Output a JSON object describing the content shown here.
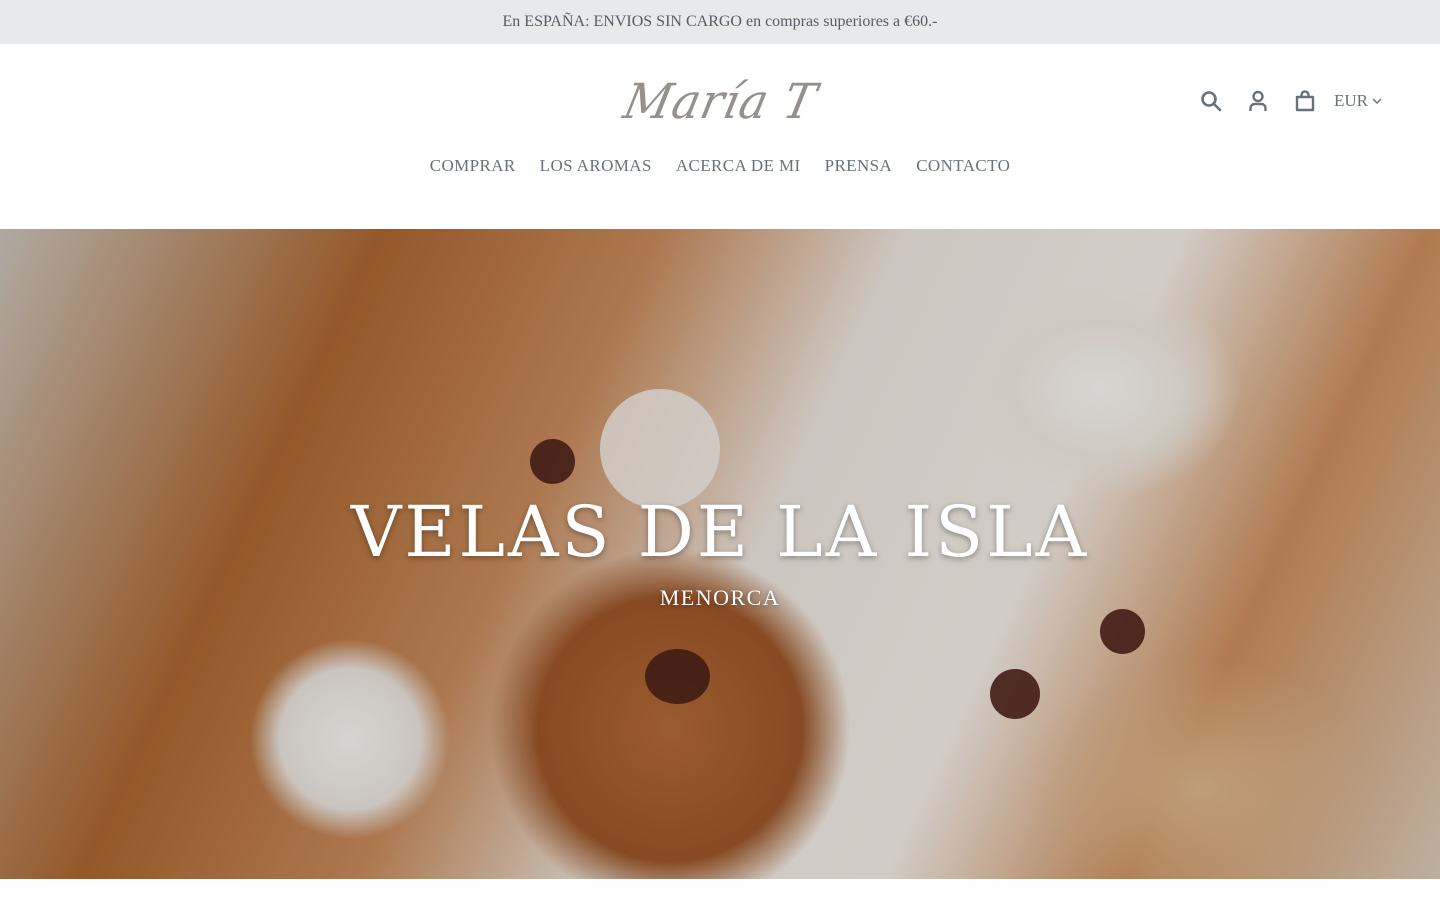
{
  "announcement": {
    "text": "En ESPAÑA: ENVIOS SIN CARGO en compras superiores a €60.-"
  },
  "header": {
    "logo_text": "María T",
    "icons": [
      "search-icon",
      "account-icon",
      "cart-icon"
    ],
    "currency": "EUR"
  },
  "nav": {
    "items": [
      {
        "label": "COMPRAR"
      },
      {
        "label": "LOS AROMAS"
      },
      {
        "label": "ACERCA DE MI"
      },
      {
        "label": "PRENSA"
      },
      {
        "label": "CONTACTO"
      }
    ]
  },
  "hero": {
    "title": "VELAS DE LA ISLA",
    "subtitle": "MENORCA"
  },
  "colors": {
    "announcement_bg": "#e8e9eb",
    "text": "#69727b",
    "hero_text": "#ffffff"
  }
}
